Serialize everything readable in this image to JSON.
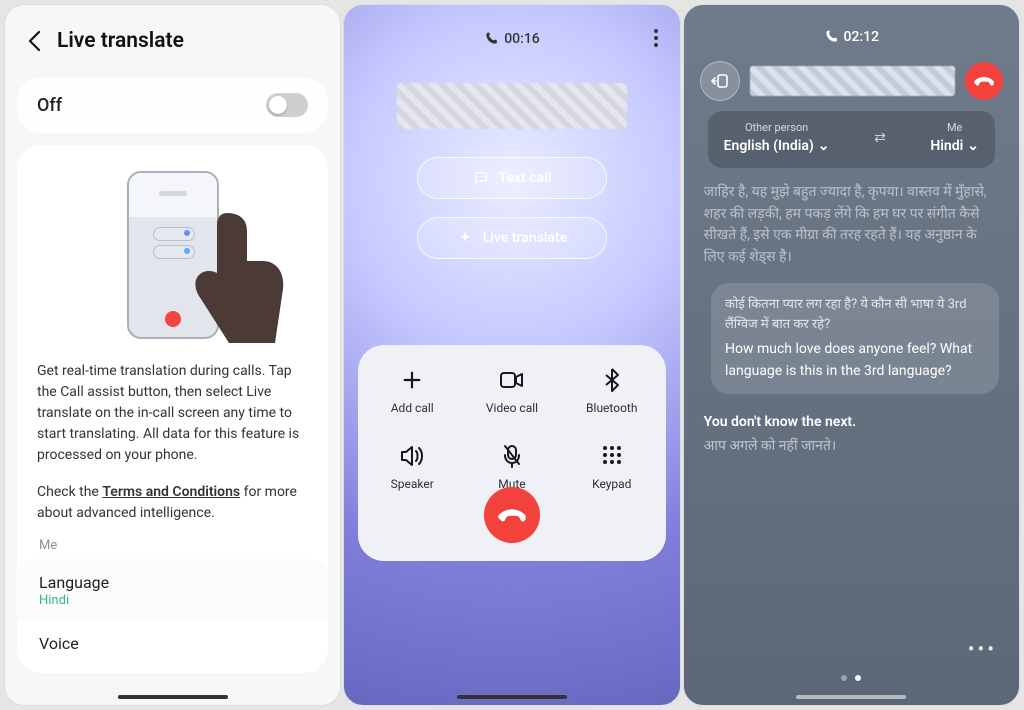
{
  "panel1": {
    "title": "Live translate",
    "toggle_label": "Off",
    "description": "Get real-time translation during calls. Tap the Call assist button, then select Live translate on the in-call screen any time to start translating. All data for this feature is processed on your phone.",
    "terms_prefix": "Check the ",
    "terms_link": "Terms and Conditions",
    "terms_suffix": " for more about advanced intelligence.",
    "me_label": "Me",
    "settings": {
      "language_label": "Language",
      "language_value": "Hindi",
      "voice_label": "Voice"
    }
  },
  "panel2": {
    "duration": "00:16",
    "text_call": "Text call",
    "live_translate": "Live translate",
    "grid": {
      "add_call": "Add call",
      "video_call": "Video call",
      "bluetooth": "Bluetooth",
      "speaker": "Speaker",
      "mute": "Mute",
      "keypad": "Keypad"
    }
  },
  "panel3": {
    "duration": "02:12",
    "other_label": "Other person",
    "other_value": "English (India)",
    "me_label": "Me",
    "me_value": "Hindi",
    "faded_text": "जाहिर है, यह मुझे बहुत ज्यादा है, कृपया। वास्तव में मुँहासे, शहर की लड़की, हम पकड़ लेंगे कि हम घर पर संगीत कैसे सीखते हैं, इसे एक मीग्रा की तरह रहते हैं। यह अनुष्ठान के लिए कई शेड्स है।",
    "bubble_hi": "कोई कितना प्यार लग रहा है? ये कौन सी भाषा ये 3rd लैंग्विज में बात कर रहे?",
    "bubble_en": "How much love does anyone feel? What language is this in the 3rd language?",
    "line_en": "You don't know the next.",
    "line_hi": "आप अगले को नहीं जानते।"
  }
}
